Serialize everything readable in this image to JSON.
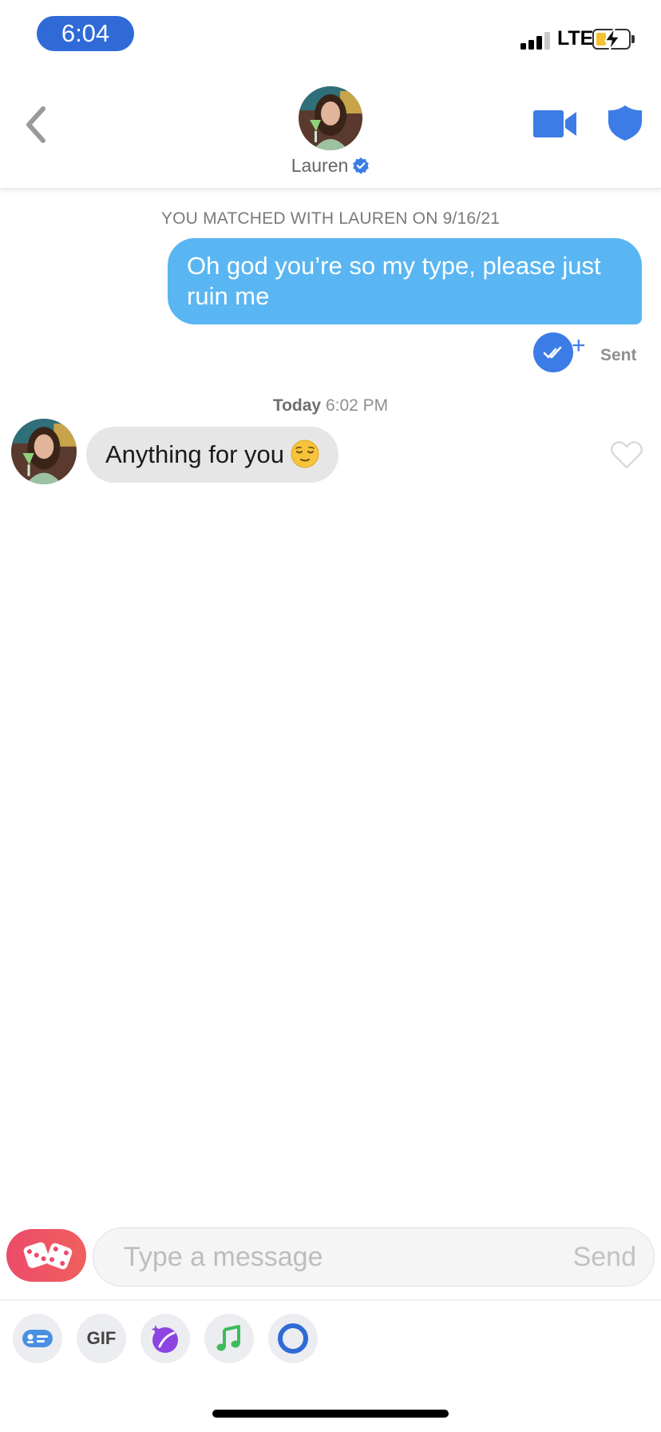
{
  "status_bar": {
    "time": "6:04",
    "network": "LTE",
    "signal_bars": 3,
    "battery_level": 0.25,
    "battery_charging": true,
    "time_pill_color": "#2f6ad6"
  },
  "header": {
    "back_icon": "chevron-left-icon",
    "contact_name": "Lauren",
    "verified": true,
    "video_icon": "video-camera-icon",
    "safety_icon": "shield-icon",
    "accent_color": "#3c7ce6"
  },
  "conversation": {
    "match_notice": "YOU MATCHED WITH LAUREN ON 9/16/21",
    "outgoing_message": {
      "text": "Oh god you’re so my type, please just ruin me",
      "status": "Sent",
      "bubble_color": "#5ab6f2"
    },
    "timestamp": {
      "day": "Today",
      "time": "6:02 PM"
    },
    "incoming_message": {
      "text": "Anything for you",
      "emoji": "relieved-face-emoji",
      "bubble_color": "#e6e6e6"
    }
  },
  "composer": {
    "placeholder": "Type a message",
    "send_label": "Send",
    "dice_icon": "dice-icon"
  },
  "toolbar": {
    "items": [
      {
        "icon": "contact-card-icon"
      },
      {
        "label": "GIF"
      },
      {
        "icon": "sticker-icon"
      },
      {
        "icon": "music-note-icon"
      },
      {
        "icon": "circle-ring-icon"
      }
    ]
  }
}
